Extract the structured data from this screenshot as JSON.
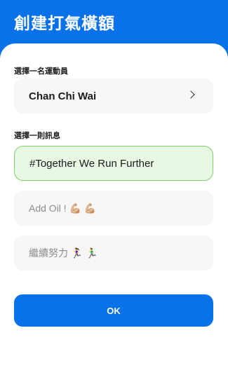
{
  "header": {
    "title": "創建打氣橫額"
  },
  "athlete_section": {
    "label": "選擇一名運動員",
    "selected_athlete": "Chan Chi Wai",
    "chevron_icon": "chevron-right-icon"
  },
  "message_section": {
    "label": "選擇一則訊息",
    "options": [
      {
        "text": "#Together We Run Further",
        "selected": true
      },
      {
        "text": "Add Oil ! 💪🏼 💪🏼",
        "selected": false
      },
      {
        "text": "繼續努力 🏃‍♀️ 🏃‍♂️",
        "selected": false
      }
    ]
  },
  "ok_button": {
    "label": "OK"
  },
  "colors": {
    "brand_blue": "#0a72e8",
    "selected_bg": "#e9f8e5",
    "selected_border": "#7fd16a",
    "card_bg": "#f7f7f8"
  }
}
